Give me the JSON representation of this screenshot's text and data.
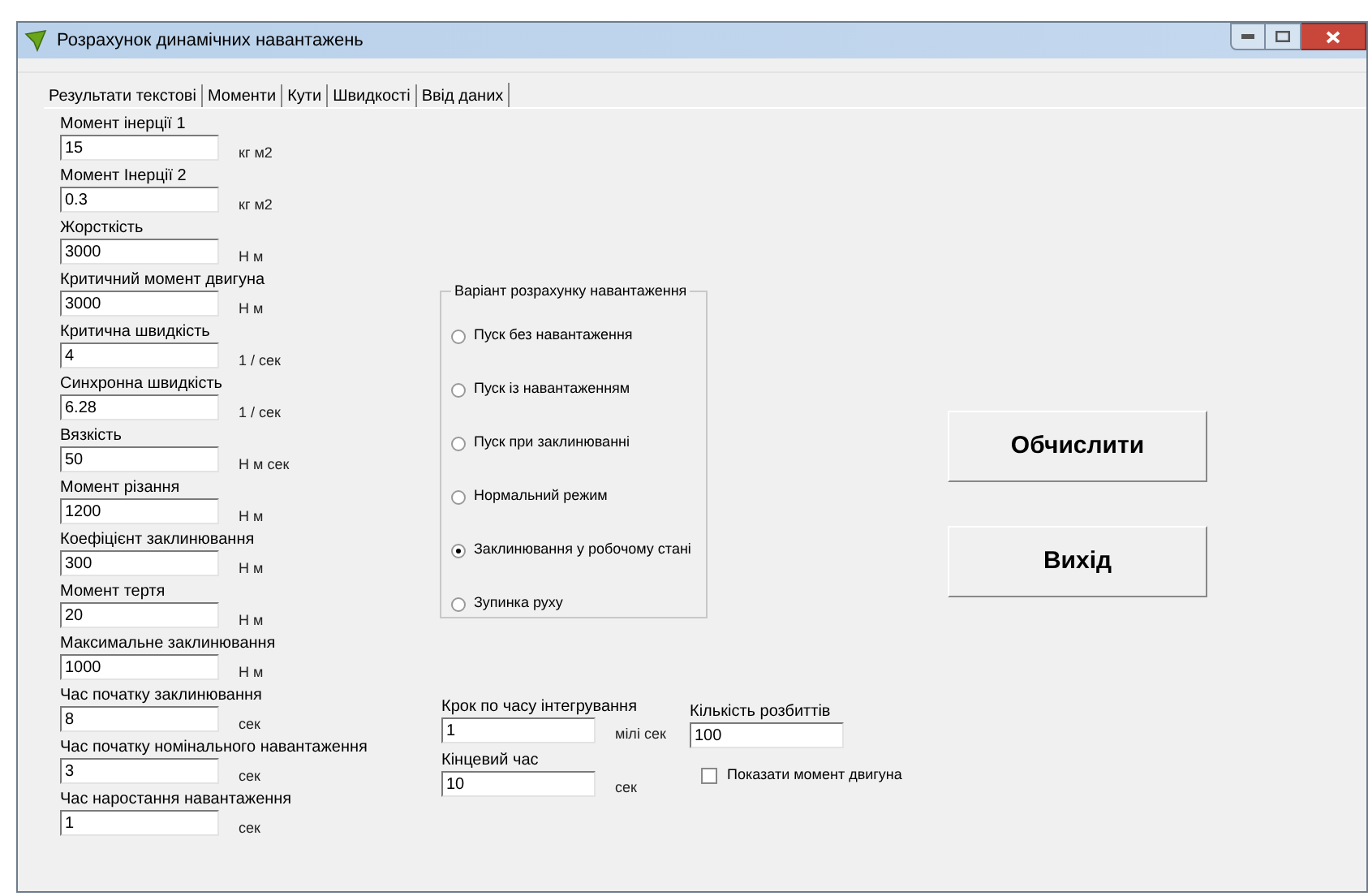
{
  "window": {
    "title": "Розрахунок динамічних навантажень"
  },
  "tabs": [
    {
      "label": "Результати текстові",
      "selected": false
    },
    {
      "label": "Моменти",
      "selected": false
    },
    {
      "label": "Кути",
      "selected": false
    },
    {
      "label": "Швидкості",
      "selected": false
    },
    {
      "label": "Ввід даних",
      "selected": true
    }
  ],
  "fields": [
    {
      "label": "Момент інерції 1",
      "value": "15",
      "unit": "кг м2"
    },
    {
      "label": "Момент Інерції 2",
      "value": "0.3",
      "unit": "кг м2"
    },
    {
      "label": "Жорсткість",
      "value": "3000",
      "unit": "Н м"
    },
    {
      "label": "Критичний момент двигуна",
      "value": "3000",
      "unit": "Н м"
    },
    {
      "label": "Критична швидкість",
      "value": "4",
      "unit": "1 / сек"
    },
    {
      "label": "Синхронна швидкість",
      "value": "6.28",
      "unit": "1 / сек"
    },
    {
      "label": "Вязкість",
      "value": "50",
      "unit": "Н м сек"
    },
    {
      "label": "Момент різання",
      "value": "1200",
      "unit": "Н м"
    },
    {
      "label": "Коефіцієнт заклинювання",
      "value": "300",
      "unit": "Н м"
    },
    {
      "label": "Момент тертя",
      "value": "20",
      "unit": "Н м"
    },
    {
      "label": "Максимальне заклинювання",
      "value": "1000",
      "unit": "Н м"
    },
    {
      "label": "Час початку заклинювання",
      "value": "8",
      "unit": "сек"
    },
    {
      "label": "Час початку номінального навантаження",
      "value": "3",
      "unit": "сек"
    },
    {
      "label": "Час наростання навантаження",
      "value": "1",
      "unit": "сек"
    }
  ],
  "load_variant": {
    "title": "Варіант розрахунку навантаження",
    "options": [
      {
        "label": "Пуск без навантаження",
        "selected": false
      },
      {
        "label": "Пуск із навантаженням",
        "selected": false
      },
      {
        "label": "Пуск при заклинюванні",
        "selected": false
      },
      {
        "label": "Нормальний режим",
        "selected": false
      },
      {
        "label": "Заклинювання у робочому стані",
        "selected": true
      },
      {
        "label": "Зупинка руху",
        "selected": false
      }
    ]
  },
  "integration": {
    "step": {
      "label": "Крок по часу інтегрування",
      "value": "1",
      "unit": "мілі сек"
    },
    "end_time": {
      "label": "Кінцевий час",
      "value": "10",
      "unit": "сек"
    },
    "partitions": {
      "label": "Кількість розбиттів",
      "value": "100"
    },
    "show_motor_torque": {
      "label": "Показати момент двигуна",
      "checked": false
    }
  },
  "buttons": [
    "Обчислити",
    "Вихід"
  ]
}
